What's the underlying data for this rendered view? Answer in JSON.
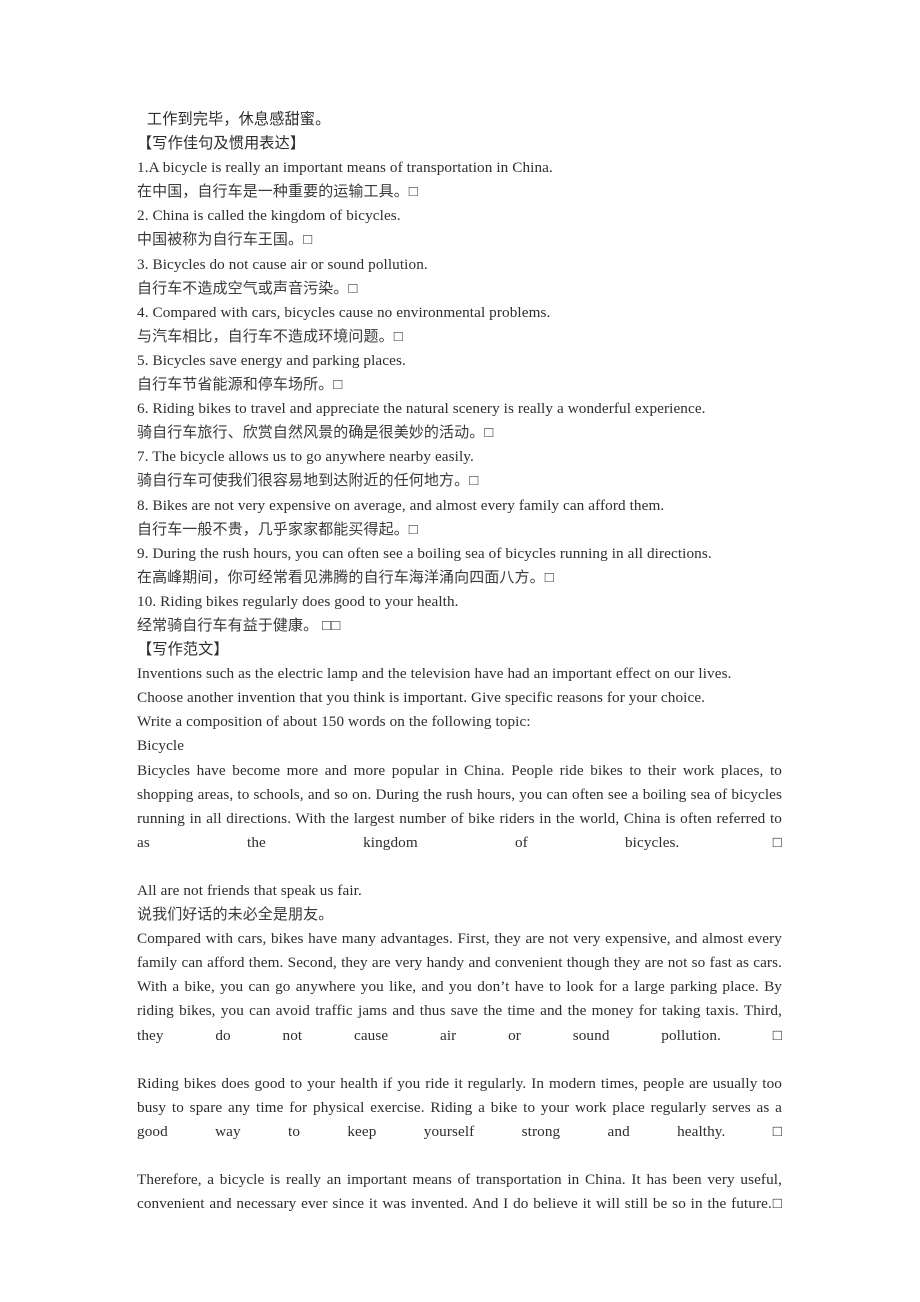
{
  "document": {
    "proverb_line": " 工作到完毕，休息感甜蜜。",
    "section_sentences_heading": "【写作佳句及惯用表达】",
    "section_model_essay_heading": "【写作范文】",
    "sentences": [
      {
        "en": "1.A bicycle is really an important means of transportation in China.",
        "cn": "在中国，自行车是一种重要的运输工具。□"
      },
      {
        "en": "2. China is called the kingdom of bicycles.",
        "cn": "中国被称为自行车王国。□"
      },
      {
        "en": "3. Bicycles do not cause air or sound pollution.",
        "cn": "自行车不造成空气或声音污染。□"
      },
      {
        "en": "4. Compared with cars, bicycles cause no environmental problems.",
        "cn": "与汽车相比，自行车不造成环境问题。□"
      },
      {
        "en": "5. Bicycles save energy and parking places.",
        "cn": "自行车节省能源和停车场所。□"
      },
      {
        "en": "6. Riding bikes to travel and appreciate the natural scenery is really a wonderful experience.",
        "cn": "骑自行车旅行、欣赏自然风景的确是很美妙的活动。□"
      },
      {
        "en": "7. The bicycle allows us to go anywhere nearby easily.",
        "cn": "骑自行车可使我们很容易地到达附近的任何地方。□"
      },
      {
        "en": "8. Bikes are not very expensive on average, and almost every family can afford them.",
        "cn": "自行车一般不贵，几乎家家都能买得起。□"
      },
      {
        "en": "9. During the rush hours, you can often see a boiling sea of bicycles running in all directions.",
        "cn": "在高峰期间，你可经常看见沸腾的自行车海洋涌向四面八方。□"
      },
      {
        "en": "10. Riding bikes regularly does good to your health.",
        "cn": "经常骑自行车有益于健康。 □□"
      }
    ],
    "essay_prompt": [
      "Inventions such as the electric lamp and the television have had an important effect on our lives.",
      "Choose another invention that you think is important. Give specific reasons for your choice.",
      "Write a composition of about 150 words on the following topic:",
      "Bicycle"
    ],
    "essay_paragraphs": [
      "Bicycles have become more and more popular in China. People ride bikes to their work places, to shopping areas, to schools, and so on. During the rush hours, you can often see a boiling sea of bicycles running in all directions. With the largest number of bike riders in the world, China is often referred to as the kingdom of bicycles.□"
    ],
    "proverb_en": "All are not friends that speak us fair.",
    "proverb_cn": "说我们好话的未必全是朋友。",
    "essay_paragraphs_2": [
      "Compared with cars, bikes have many advantages. First, they are not very expensive, and almost every family can afford them. Second, they are very handy and convenient though they are not so fast as cars. With a bike, you can go anywhere you like, and you don’t have to look for a large parking place. By riding bikes, you can avoid traffic jams and thus save the time and the money for taking taxis. Third, they do not cause air or sound pollution. □",
      "Riding bikes does good to your health if you ride it regularly. In modern times, people are usually too busy to spare any time for physical exercise. Riding a bike to your work place regularly serves as a good way to keep yourself strong and healthy. □",
      "Therefore, a bicycle is really an important means of transportation in China. It has been very useful, convenient and necessary ever since it was invented. And I do believe it will still be so in the future.□"
    ]
  }
}
